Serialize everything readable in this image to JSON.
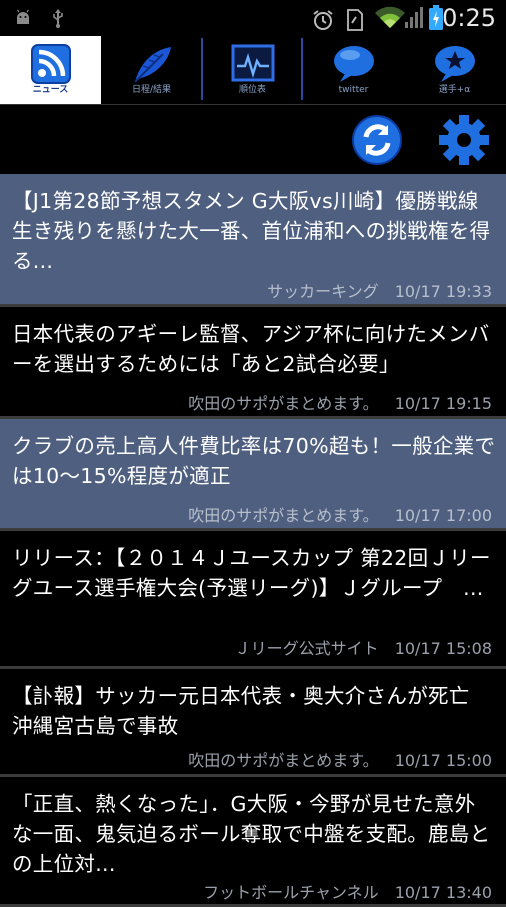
{
  "status_bar": {
    "time": "0:25",
    "icons": [
      "android-debug-icon",
      "usb-icon",
      "alarm-icon",
      "sim-icon",
      "wifi-icon",
      "signal-icon",
      "battery-icon"
    ]
  },
  "tabs": [
    {
      "label": "ニュース",
      "icon": "rss-icon",
      "active": true
    },
    {
      "label": "日程/結果",
      "icon": "feather-icon",
      "active": false
    },
    {
      "label": "順位表",
      "icon": "chart-icon",
      "active": false
    },
    {
      "label": "twitter",
      "icon": "speech-bubble-icon",
      "active": false
    },
    {
      "label": "選手+α",
      "icon": "star-bubble-icon",
      "active": false
    }
  ],
  "toolbar": {
    "refresh": "refresh-icon",
    "settings": "gear-icon"
  },
  "news": [
    {
      "title": "【J1第28節予想スタメン G大阪vs川崎】優勝戦線生き残りを懸けた大一番、首位浦和への挑戦権を得る...",
      "source": "サッカーキング",
      "time": "10/17 19:33",
      "highlighted": true
    },
    {
      "title": "日本代表のアギーレ監督、アジア杯に向けたメンバーを選出するためには「あと2試合必要」",
      "source": "吹田のサポがまとめます。",
      "time": "10/17 19:15",
      "highlighted": false
    },
    {
      "title": "クラブの売上高人件費比率は70%超も！一般企業では10～15%程度が適正",
      "source": "吹田のサポがまとめます。",
      "time": "10/17 17:00",
      "highlighted": true
    },
    {
      "title": "リリース：【２０１４Ｊユースカップ 第22回Ｊリーグユース選手権大会(予選リーグ)】Ｊグループ　...",
      "source": "Ｊリーグ公式サイト",
      "time": "10/17 15:08",
      "highlighted": false
    },
    {
      "title": "【訃報】サッカー元日本代表・奥大介さんが死亡　沖縄宮古島で事故",
      "source": "吹田のサポがまとめます。",
      "time": "10/17 15:00",
      "highlighted": false
    },
    {
      "title": "「正直、熱くなった」．G大阪・今野が見せた意外な一面、鬼気迫るボール奪取で中盤を支配。鹿島との上位対...",
      "source": "フットボールチャンネル",
      "time": "10/17 13:40",
      "highlighted": false
    }
  ]
}
